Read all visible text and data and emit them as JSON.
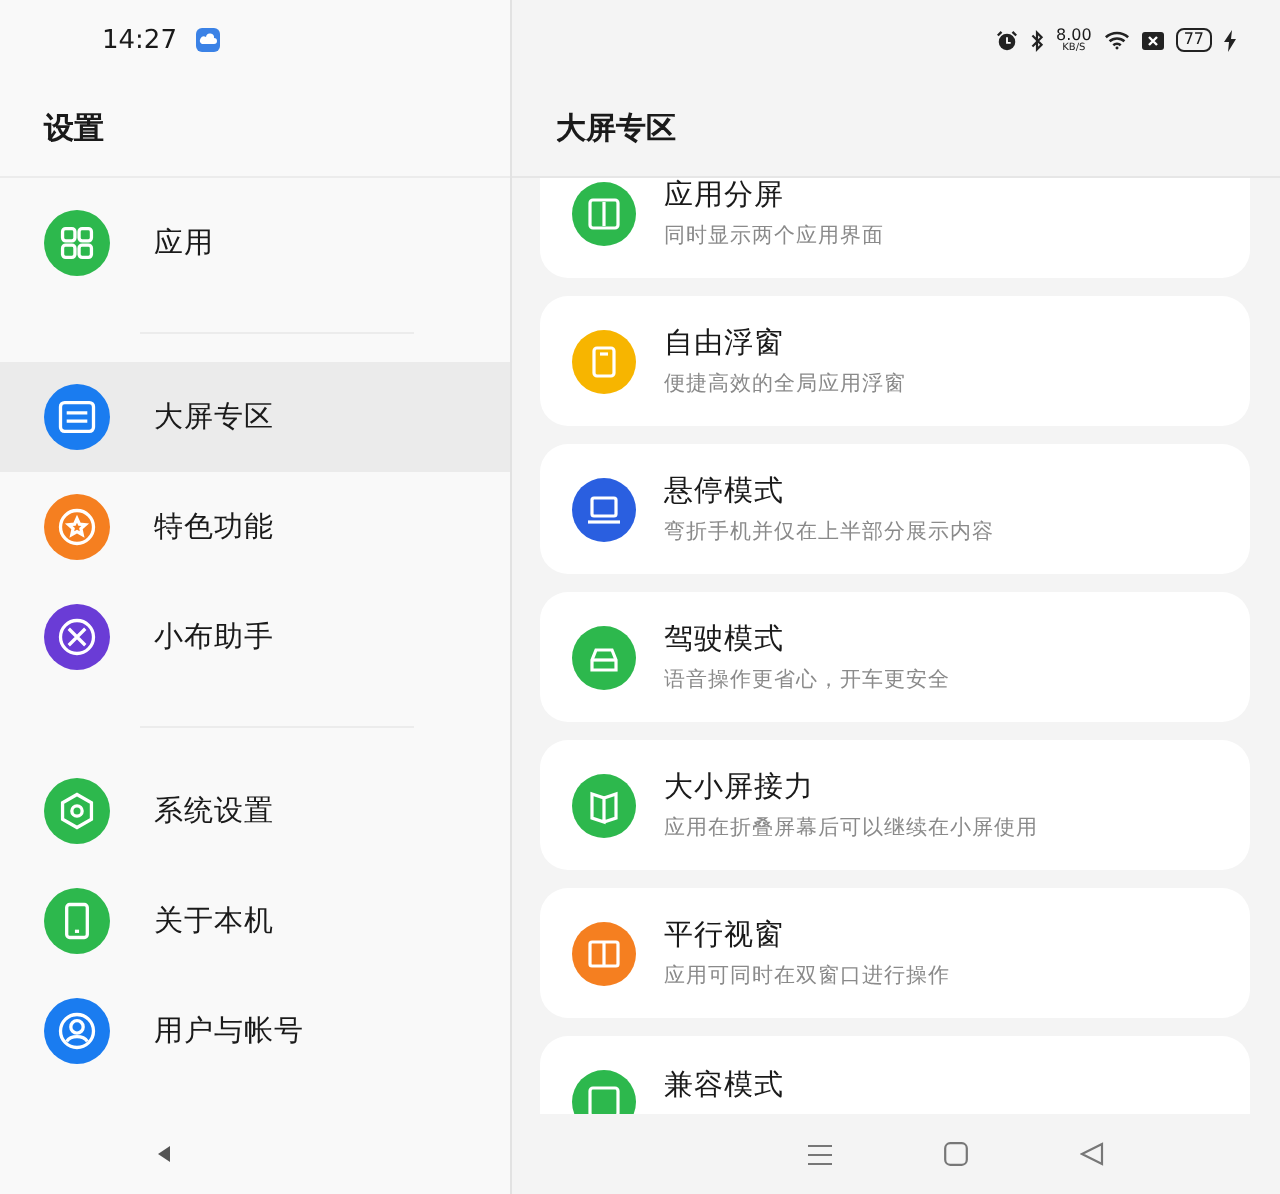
{
  "status_bar": {
    "time": "14:27",
    "net_speed": "8.00",
    "net_unit": "KB/S",
    "battery": "77"
  },
  "sidebar": {
    "title": "设置",
    "groups": [
      [
        {
          "label": "应用",
          "kind": "apps",
          "color": "#2db84d",
          "selected": false
        }
      ],
      [
        {
          "label": "大屏专区",
          "kind": "screen",
          "color": "#1a7cf0",
          "selected": true
        },
        {
          "label": "特色功能",
          "kind": "star",
          "color": "#f57f20",
          "selected": false
        },
        {
          "label": "小布助手",
          "kind": "assistant",
          "color": "#6a3cd6",
          "selected": false
        }
      ],
      [
        {
          "label": "系统设置",
          "kind": "gear",
          "color": "#2db84d",
          "selected": false
        },
        {
          "label": "关于本机",
          "kind": "phone",
          "color": "#2db84d",
          "selected": false
        },
        {
          "label": "用户与帐号",
          "kind": "user",
          "color": "#1a7cf0",
          "selected": false
        }
      ]
    ]
  },
  "content": {
    "title": "大屏专区",
    "items": [
      {
        "title": "应用分屏",
        "subtitle": "同时显示两个应用界面",
        "kind": "split",
        "color": "#2db84d"
      },
      {
        "title": "自由浮窗",
        "subtitle": "便捷高效的全局应用浮窗",
        "kind": "float",
        "color": "#f7b500"
      },
      {
        "title": "悬停模式",
        "subtitle": "弯折手机并仅在上半部分展示内容",
        "kind": "laptop",
        "color": "#2a5fe0"
      },
      {
        "title": "驾驶模式",
        "subtitle": "语音操作更省心，开车更安全",
        "kind": "car",
        "color": "#2db84d"
      },
      {
        "title": "大小屏接力",
        "subtitle": "应用在折叠屏幕后可以继续在小屏使用",
        "kind": "fold",
        "color": "#2db84d"
      },
      {
        "title": "平行视窗",
        "subtitle": "应用可同时在双窗口进行操作",
        "kind": "columns",
        "color": "#f57f20"
      },
      {
        "title": "兼容模式",
        "kind": "frame",
        "color": "#2db84d"
      }
    ]
  }
}
